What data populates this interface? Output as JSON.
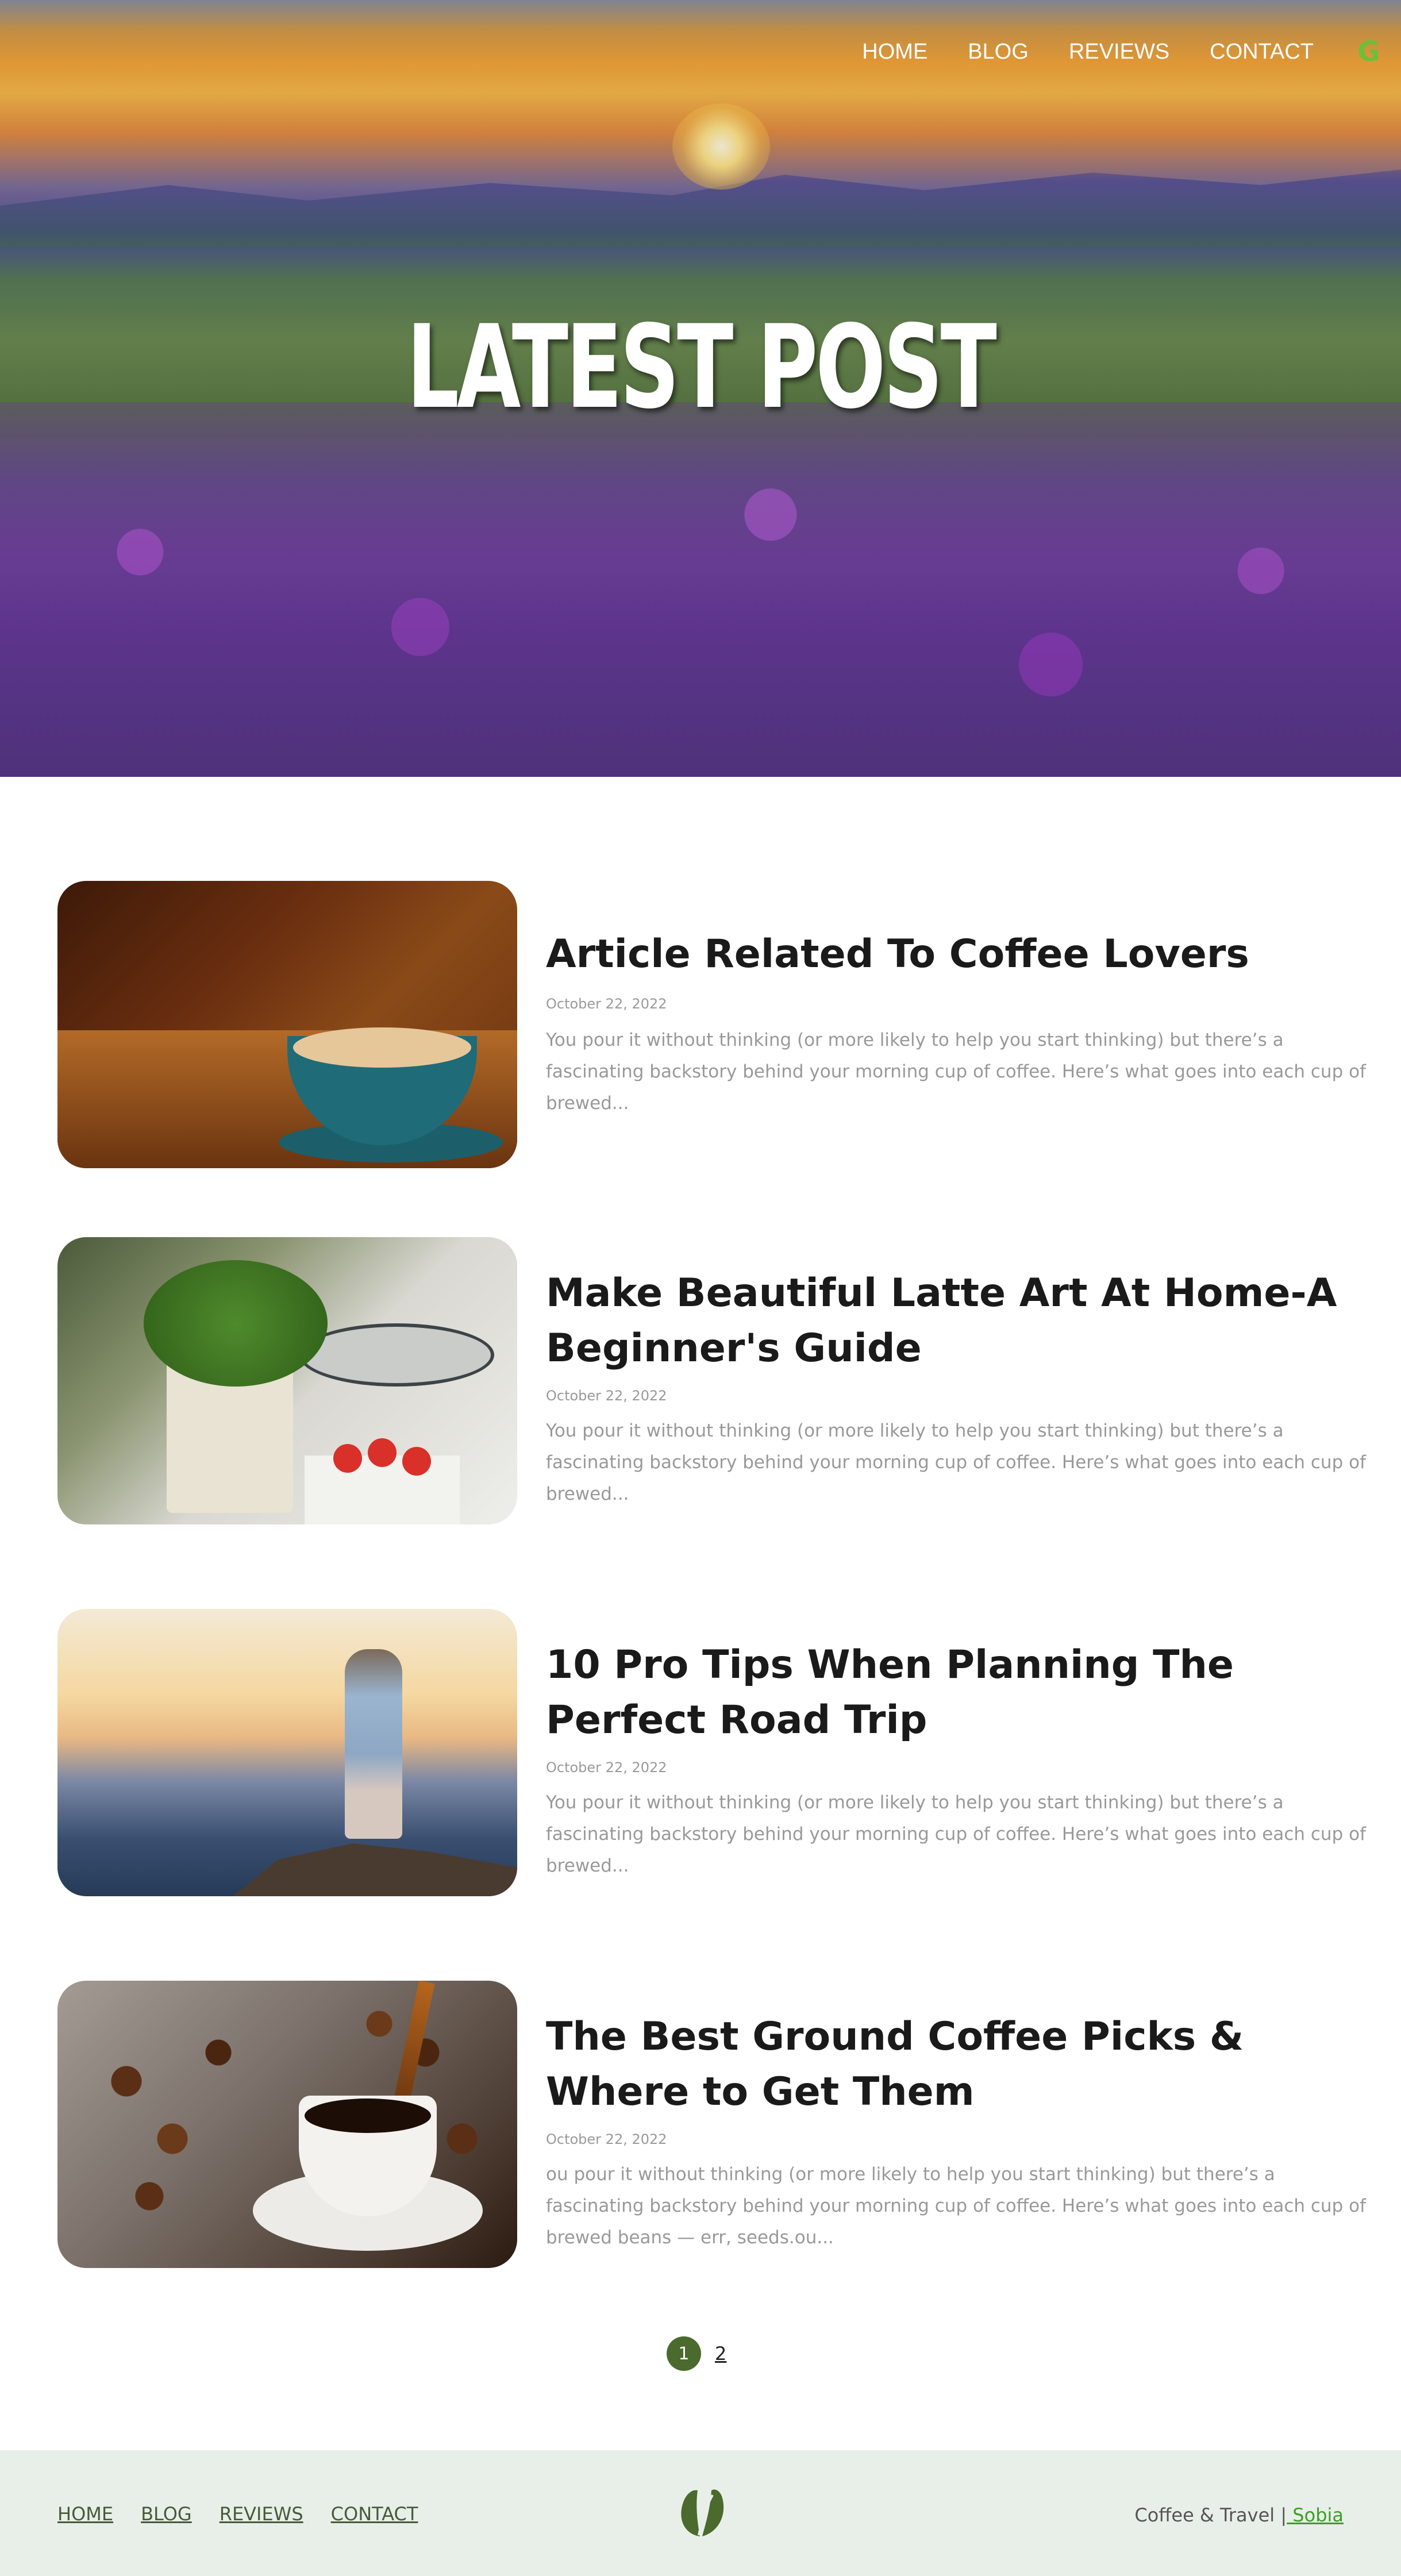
{
  "nav": {
    "items": [
      "HOME",
      "BLOG",
      "REVIEWS",
      "CONTACT"
    ],
    "icon": "g-logo-icon"
  },
  "hero": {
    "title": "LATEST POST"
  },
  "posts": [
    {
      "title": "Article Related To Coffee Lovers",
      "date": "October 22, 2022",
      "excerpt": "You pour it without thinking (or more likely to help you start thinking) but there’s a fascinating backstory behind your morning cup of coffee. Here’s what goes into each cup of brewed..."
    },
    {
      "title": "Make Beautiful Latte Art At Home-A Beginner's Guide",
      "date": "October 22, 2022",
      "excerpt": "You pour it without thinking (or more likely to help you start thinking) but there’s a fascinating backstory behind your morning cup of coffee. Here’s what goes into each cup of brewed..."
    },
    {
      "title": "10 Pro Tips When Planning The Perfect Road Trip",
      "date": "October 22, 2022",
      "excerpt": "You pour it without thinking (or more likely to help you start thinking) but there’s a fascinating backstory behind your morning cup of coffee. Here’s what goes into each cup of brewed..."
    },
    {
      "title": "The Best Ground Coffee Picks & Where to Get Them",
      "date": "October 22, 2022",
      "excerpt": "ou pour it without thinking (or more likely to help you start thinking) but there’s a fascinating backstory behind your morning cup of coffee. Here’s what goes into each cup of brewed beans — err, seeds.ou..."
    }
  ],
  "pagination": {
    "current": "1",
    "next": "2"
  },
  "footer": {
    "nav": [
      "HOME",
      "BLOG",
      "REVIEWS",
      "CONTACT"
    ],
    "credit_text": "Coffee & Travel |",
    "credit_link": " Sobia",
    "logo_icon": "leaf-logo-icon"
  },
  "colors": {
    "accent": "#4a6a2e",
    "footer_bg": "#e8efe8",
    "link_green": "#3aa027"
  }
}
